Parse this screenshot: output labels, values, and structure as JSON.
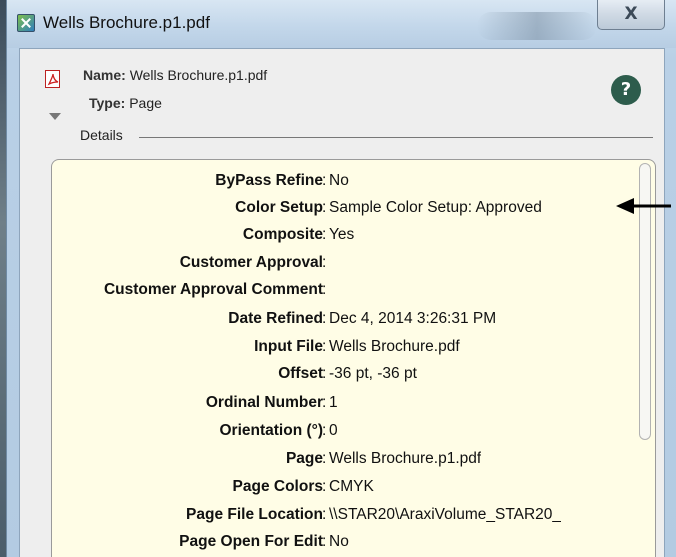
{
  "window": {
    "title": "Wells Brochure.p1.pdf",
    "close_label": "X"
  },
  "header": {
    "name_label": "Name:",
    "name_value": "Wells Brochure.p1.pdf",
    "type_label": "Type:",
    "type_value": "Page",
    "help_label": "?"
  },
  "details": {
    "label": "Details",
    "rows": [
      {
        "key": "ByPass Refine",
        "value": "No"
      },
      {
        "key": "Color Setup",
        "value": "Sample Color Setup: Approved"
      },
      {
        "key": "Composite",
        "value": "Yes"
      },
      {
        "key": "Customer Approval",
        "value": ""
      },
      {
        "key": "Customer Approval Comment",
        "value": ""
      },
      {
        "key": "Date Refined",
        "value": "Dec 4, 2014 3:26:31 PM"
      },
      {
        "key": "Input File",
        "value": "Wells Brochure.pdf"
      },
      {
        "key": "Offset",
        "value": "-36 pt, -36 pt"
      },
      {
        "key": "Ordinal Number",
        "value": "1"
      },
      {
        "key": "Orientation (°)",
        "value": "0"
      },
      {
        "key": "Page",
        "value": "Wells Brochure.p1.pdf"
      },
      {
        "key": "Page Colors",
        "value": "CMYK"
      },
      {
        "key": "Page File Location",
        "value": "\\\\STAR20\\AraxiVolume_STAR20_"
      },
      {
        "key": "Page Open For Edit",
        "value": "No"
      }
    ]
  }
}
